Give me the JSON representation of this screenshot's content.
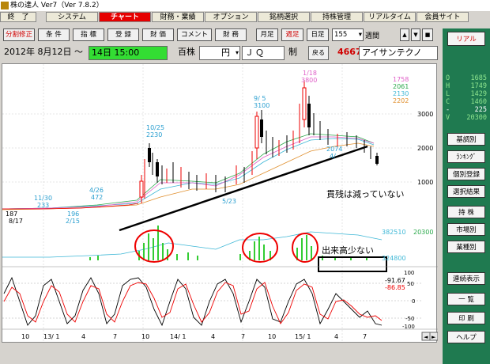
{
  "app": {
    "title": "株の達人 Ver7（Ver 7.8.2）"
  },
  "menu": [
    {
      "label": "終　了"
    },
    {
      "label": "システム"
    },
    {
      "label": "チャート"
    },
    {
      "label": "財務・業績"
    },
    {
      "label": "オプション"
    },
    {
      "label": "銘柄選択"
    },
    {
      "label": "持株管理"
    },
    {
      "label": "リアルタイム"
    },
    {
      "label": "会員サイト"
    }
  ],
  "toolbar": {
    "buttons": [
      "分割修正",
      "条 件",
      "指 標",
      "登 録",
      "財 価",
      "コメント",
      "財 務",
      "月足",
      "週足",
      "日足"
    ],
    "period_select": "155",
    "period_unit": "週間",
    "right_button": "リアル"
  },
  "infobar": {
    "date_from": "2012年 8月12日 ～",
    "date_to": "14日 15:00",
    "unit": "百株",
    "currency": "円",
    "market": "ＪＱ",
    "type": "制",
    "back_button": "戻る",
    "code": "4667",
    "name": "アイサンテクノ"
  },
  "quote": [
    {
      "k": "O",
      "v": "1685"
    },
    {
      "k": "H",
      "v": "1749"
    },
    {
      "k": "L",
      "v": "1429"
    },
    {
      "k": "C",
      "v": "1460"
    },
    {
      "k": "-",
      "v": "225"
    },
    {
      "k": "V",
      "v": "20300"
    }
  ],
  "side_buttons": [
    "基調別",
    "ﾗﾝｷﾝｸﾞ",
    "個別登録",
    "選択結果",
    "持 株",
    "市場別",
    "業種別",
    "連続表示",
    "一 覧",
    "印 刷",
    "ヘルプ"
  ],
  "chart": {
    "ma_values": [
      "1758",
      "2061",
      "2130",
      "2202"
    ],
    "price_ticks": [
      "3000",
      "2000",
      "1000"
    ],
    "annotations": [
      {
        "label": "10/25",
        "value": "2230"
      },
      {
        "label": "9/ 5",
        "value": "3100"
      },
      {
        "label": "1/18",
        "value": "3800"
      },
      {
        "label": "11/30",
        "value": "233"
      },
      {
        "label": "4/26",
        "value": "472"
      },
      {
        "label": "196",
        "value": "2/15"
      },
      {
        "label": "187",
        "value": "8/17"
      },
      {
        "label": "5/23",
        "value": ""
      },
      {
        "label": "2074",
        "value": "4/"
      }
    ],
    "note_zandaka": "貫残は減っていない",
    "note_volume": "出来高少ない",
    "volume_values": [
      "382510",
      "20300",
      "324800"
    ],
    "osc_values": [
      "-91.67",
      "-86.85"
    ],
    "osc_ticks": [
      "100",
      "50",
      "0",
      "-50",
      "-100"
    ],
    "x_ticks": [
      "10",
      "13/ 1",
      "4",
      "7",
      "10",
      "14/ 1",
      "4",
      "7",
      "10",
      "15/ 1",
      "4",
      "7"
    ]
  },
  "colors": {
    "active_menu": "#e60000",
    "candle_up": "#e60000",
    "candle_down": "#000000",
    "panel": "#1f7a50"
  }
}
